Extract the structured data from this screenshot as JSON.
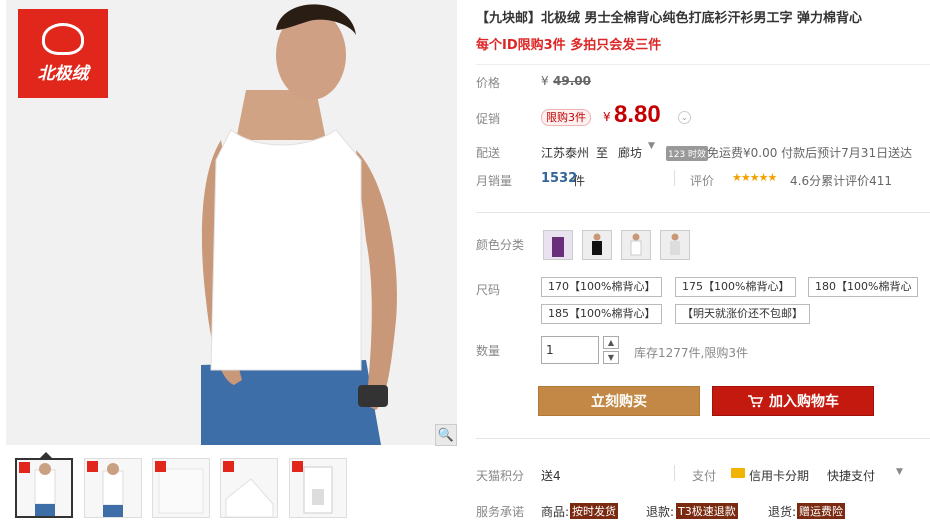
{
  "brand": {
    "logo_text": "北极绒"
  },
  "product": {
    "title": "【九块邮】北极绒 男士全棉背心纯色打底衫汗衫男工字 弹力棉背心",
    "subtitle": "每个ID限购3件 多拍只会发三件"
  },
  "price": {
    "label": "价格",
    "currency": "¥",
    "original": "49.00",
    "promo_label": "促销",
    "promo_badge": "限购3件",
    "sale": "8.80"
  },
  "delivery": {
    "label": "配送",
    "from": "江苏泰州",
    "to_word": "至",
    "to": "廊坊",
    "badge": "123 时效",
    "info": "免运费¥0.00 付款后预计7月31日送达"
  },
  "sales": {
    "label": "月销量",
    "count": "1532",
    "unit": "件",
    "rating_label": "评价",
    "stars": "★★★★★",
    "rating": "4.6分累计评价411"
  },
  "options": {
    "color_label": "颜色分类",
    "size_label": "尺码",
    "sizes": [
      "170【100%棉背心】",
      "175【100%棉背心】",
      "180【100%棉背心",
      "185【100%棉背心】",
      "【明天就涨价还不包邮】"
    ],
    "qty_label": "数量",
    "qty_value": "1",
    "stock": "库存1277件,限购3件"
  },
  "actions": {
    "buy": "立刻购买",
    "cart": "加入购物车"
  },
  "service": {
    "points_label": "天猫积分",
    "points_value": "送4",
    "pay_label": "支付",
    "pay_card": "信用卡分期",
    "pay_fast": "快捷支付",
    "promise_label": "服务承诺",
    "promise_items": [
      "商品:",
      "按时发货",
      "退款:",
      "T3极速退款",
      "退货:",
      "赠运费险"
    ]
  },
  "colors": {
    "accent_red": "#c40000",
    "buy": "#c38845",
    "cart": "#c4190e",
    "brand": "#e1261c"
  }
}
